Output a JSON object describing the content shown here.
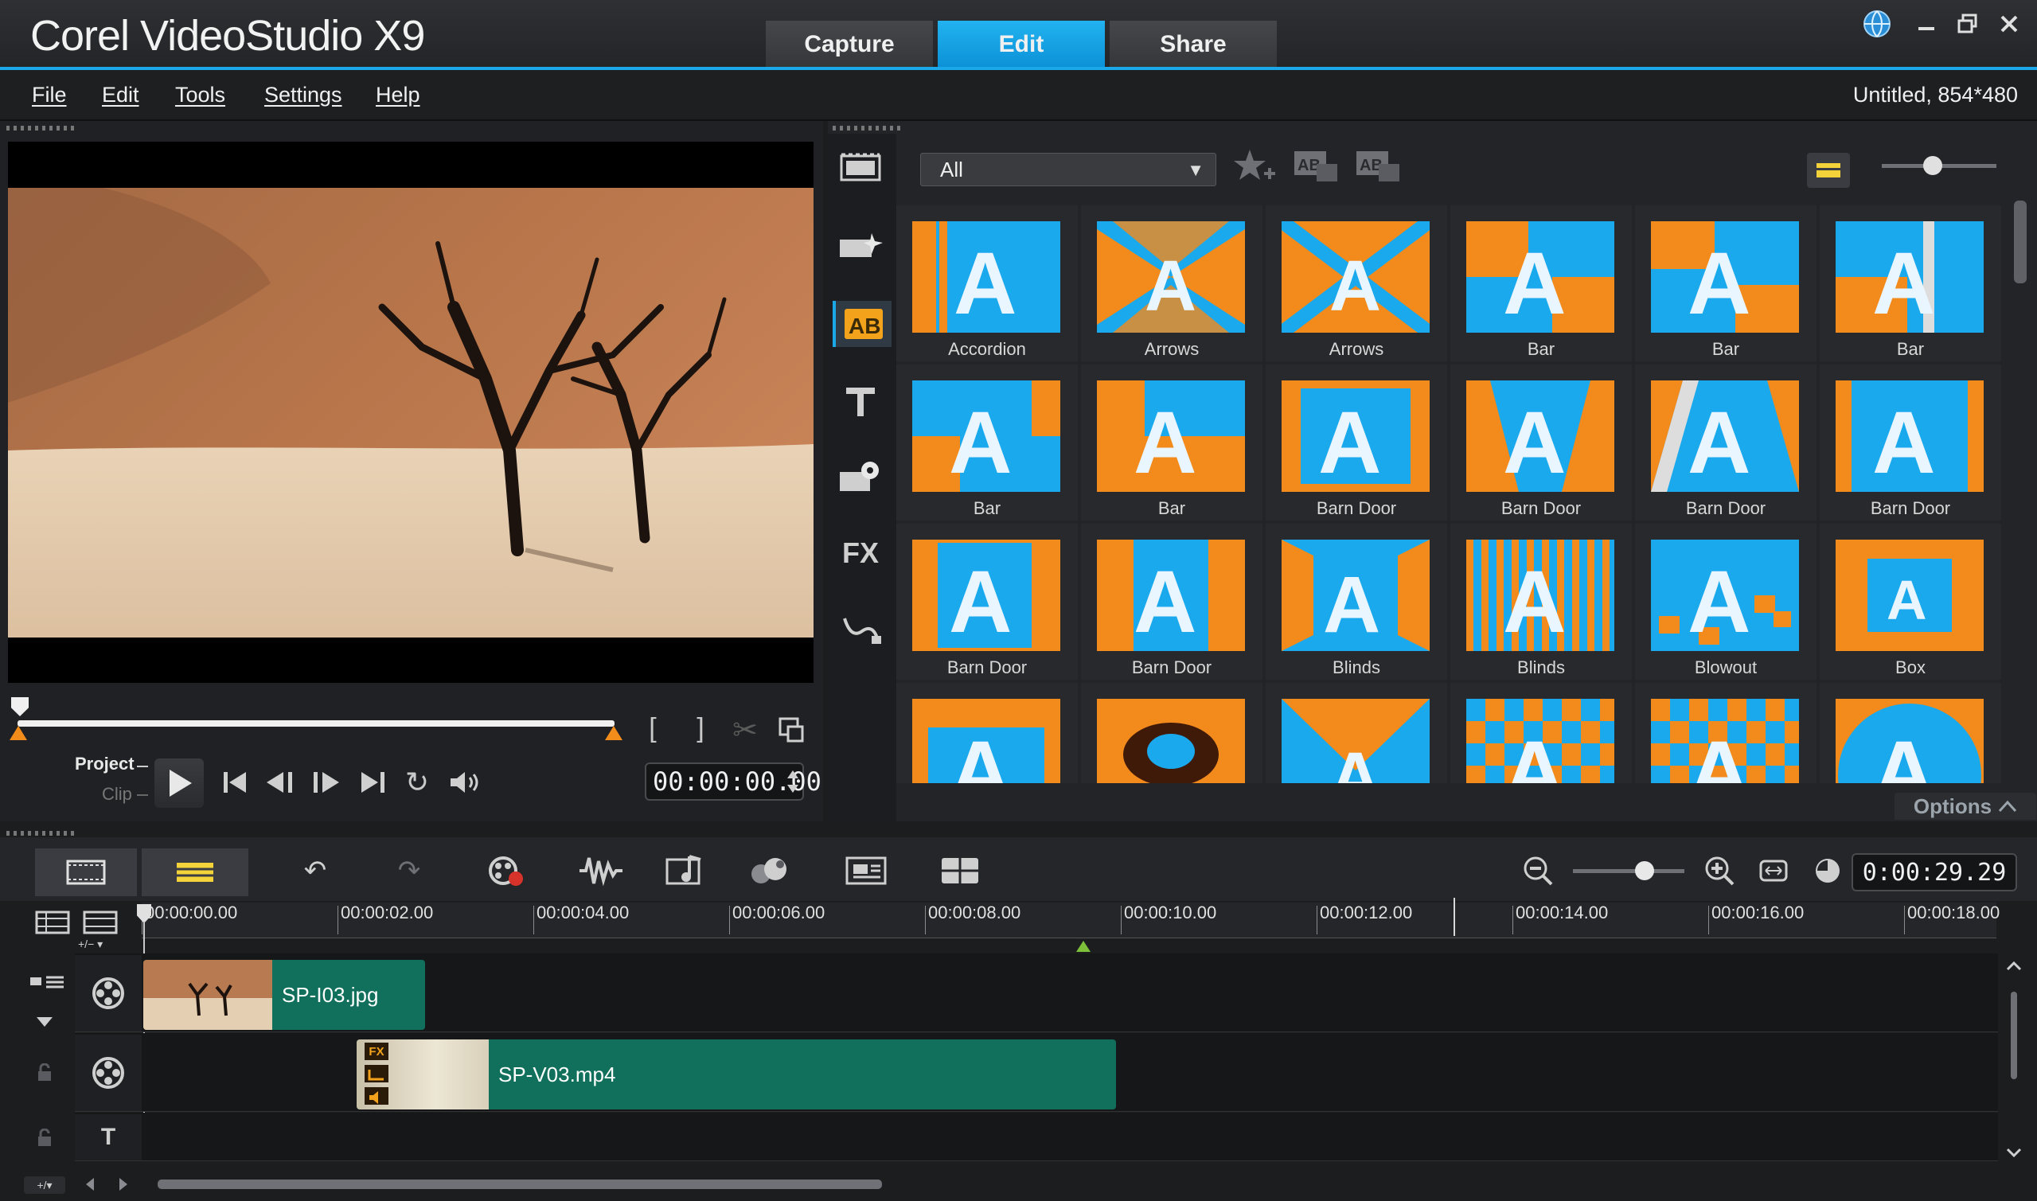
{
  "app": {
    "title": "Corel VideoStudio X9",
    "modes": [
      "Capture",
      "Edit",
      "Share"
    ],
    "active_mode": "Edit",
    "project_info": "Untitled, 854*480",
    "accent_color": "#1aa8e8"
  },
  "menu": [
    "File",
    "Edit",
    "Tools",
    "Settings",
    "Help"
  ],
  "preview": {
    "project_label": "Project",
    "clip_label": "Clip",
    "timecode": "00:00:00.00",
    "mode": "Project"
  },
  "library": {
    "filter": "All",
    "active_tool": "transitions",
    "options_label": "Options",
    "tools": [
      "media-icon",
      "instant-project-icon",
      "transition-icon",
      "title-icon",
      "graphics-icon",
      "filter-icon",
      "path-icon"
    ],
    "transitions": [
      {
        "label": "Accordion"
      },
      {
        "label": "Arrows"
      },
      {
        "label": "Arrows"
      },
      {
        "label": "Bar"
      },
      {
        "label": "Bar"
      },
      {
        "label": "Bar"
      },
      {
        "label": "Bar"
      },
      {
        "label": "Bar"
      },
      {
        "label": "Barn Door"
      },
      {
        "label": "Barn Door"
      },
      {
        "label": "Barn Door"
      },
      {
        "label": "Barn Door"
      },
      {
        "label": "Barn Door"
      },
      {
        "label": "Barn Door"
      },
      {
        "label": "Blinds"
      },
      {
        "label": "Blinds"
      },
      {
        "label": "Blowout"
      },
      {
        "label": "Box"
      },
      {
        "label": ""
      },
      {
        "label": ""
      },
      {
        "label": ""
      },
      {
        "label": ""
      },
      {
        "label": ""
      },
      {
        "label": ""
      }
    ]
  },
  "timeline": {
    "timecode": "0:00:29.29",
    "ruler": [
      "00:00:00.00",
      "00:00:02.00",
      "00:00:04.00",
      "00:00:06.00",
      "00:00:08.00",
      "00:00:10.00",
      "00:00:12.00",
      "00:00:14.00",
      "00:00:16.00",
      "00:00:18.00"
    ],
    "clips": {
      "video": {
        "name": "SP-I03.jpg"
      },
      "overlay": {
        "name": "SP-V03.mp4",
        "badges": [
          "FX",
          "path",
          "audio"
        ]
      }
    },
    "title_track_label": "T"
  }
}
